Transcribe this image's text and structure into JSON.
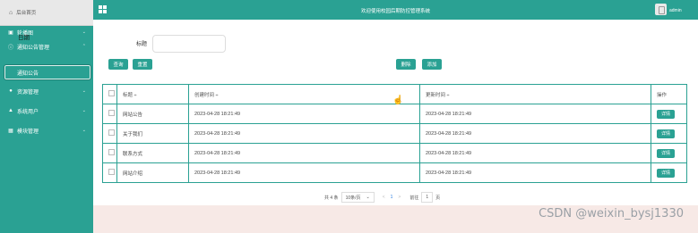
{
  "sidebar": {
    "brand": {
      "icon": "home-icon",
      "label": "后台首页"
    },
    "items": [
      {
        "icon": "image-icon",
        "label": "轮播图"
      },
      {
        "icon": "info-circle-icon",
        "label": "通知公告管理"
      },
      {
        "icon": "gear-icon",
        "label": "资源管理"
      },
      {
        "icon": "user-icon",
        "label": "系统用户"
      },
      {
        "icon": "grid-icon",
        "label": "模块管理"
      }
    ],
    "overlay_label": "日期",
    "active_sub": "通知公告"
  },
  "header": {
    "title": "欢迎使用校园后期防控管理系统",
    "user": "admin"
  },
  "search": {
    "label": "标题",
    "placeholder": ""
  },
  "buttons": {
    "query": "查询",
    "reset": "重置",
    "delete": "删除",
    "add": "添加"
  },
  "table": {
    "headers": [
      "标题 ÷",
      "创建时间 ÷",
      "更新时间 ÷",
      "操作"
    ],
    "rows": [
      {
        "title": "网站公告",
        "created": "2023-04-28 18:21:49",
        "updated": "2023-04-28 18:21:49",
        "action": "详情"
      },
      {
        "title": "关于我们",
        "created": "2023-04-28 18:21:49",
        "updated": "2023-04-28 18:21:49",
        "action": "详情"
      },
      {
        "title": "联系方式",
        "created": "2023-04-28 18:21:49",
        "updated": "2023-04-28 18:21:49",
        "action": "详情"
      },
      {
        "title": "网站介绍",
        "created": "2023-04-28 18:21:49",
        "updated": "2023-04-28 18:21:49",
        "action": "详情"
      }
    ]
  },
  "pagination": {
    "total": "共 4 条",
    "page_size": "10条/页",
    "prev": "<",
    "current": "1",
    "next": ">",
    "goto_prefix": "前往",
    "goto_value": "1",
    "goto_suffix": "页"
  },
  "watermark": "CSDN @weixin_bysj1330",
  "colors": {
    "accent": "#2aa193",
    "footer_bg": "#f7e9e6"
  }
}
